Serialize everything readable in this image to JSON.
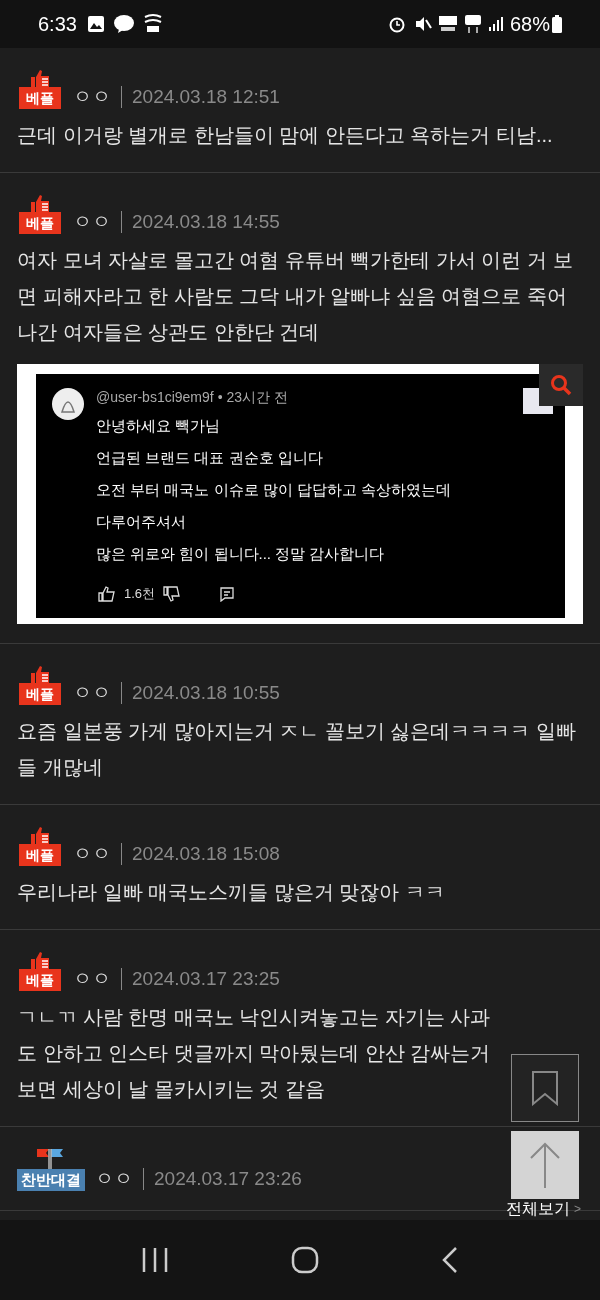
{
  "status_bar": {
    "time": "6:33",
    "battery": "68%"
  },
  "posts": [
    {
      "kind": "best",
      "badge": "베플",
      "author": "ㅇㅇ",
      "date": "2024.03.18 12:51",
      "text": "근데 이거랑 별개로 한남들이 맘에 안든다고 욕하는거 티남..."
    },
    {
      "kind": "best",
      "badge": "베플",
      "author": "ㅇㅇ",
      "date": "2024.03.18 14:55",
      "text": "여자 모녀 자살로 몰고간 여혐 유튜버 빽가한테 가서 이런 거 보면 피해자라고 한 사람도 그닥 내가 알빠냐 싶음 여혐으로 죽어나간 여자들은 상관도 안한단 건데",
      "attachment": {
        "user": "@user-bs1ci9em9f",
        "time": "• 23시간 전",
        "lines": [
          "안녕하세요 빽가님",
          "언급된 브랜드 대표 권순호 입니다",
          "오전 부터 매국노 이슈로 많이 답답하고 속상하였는데",
          "다루어주셔서",
          "많은 위로와 힘이 됩니다... 정말 감사합니다"
        ],
        "likes": "1.6천"
      }
    },
    {
      "kind": "best",
      "badge": "베플",
      "author": "ㅇㅇ",
      "date": "2024.03.18 10:55",
      "text": "요즘 일본풍 가게 많아지는거 ㅈㄴ 꼴보기 싫은데ㅋㅋㅋㅋ 일빠들 개많네"
    },
    {
      "kind": "best",
      "badge": "베플",
      "author": "ㅇㅇ",
      "date": "2024.03.18 15:08",
      "text": "우리나라 일빠 매국노스끼들 많은거 맞잖아 ㅋㅋ"
    },
    {
      "kind": "best",
      "badge": "베플",
      "author": "ㅇㅇ",
      "date": "2024.03.17 23:25",
      "text": "ㄱㄴㄲ 사람 한명 매국노 낙인시켜놓고는 자기는 사과도 안하고 인스타 댓글까지 막아뒀는데 안산 감싸는거보면 세상이 날 몰카시키는 것 같음"
    },
    {
      "kind": "debate",
      "badge": "찬반대결",
      "author": "ㅇㅇ",
      "date": "2024.03.17 23:26"
    }
  ],
  "floating": {
    "view_all": "전체보기",
    "view_all_arrow": ">"
  }
}
